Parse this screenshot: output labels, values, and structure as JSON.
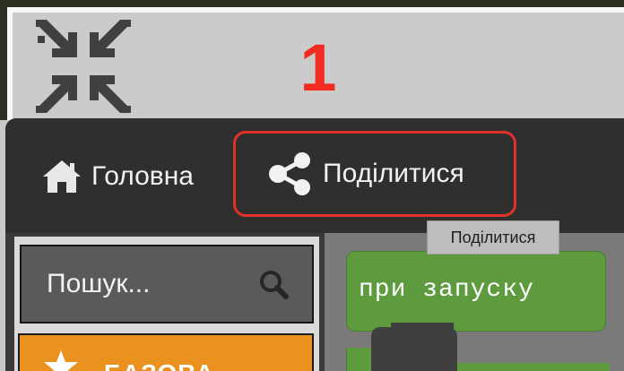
{
  "step_marker": "1",
  "icons": {
    "collapse": "collapse-arrows-icon",
    "home": "home-icon",
    "share": "share-icon",
    "search": "search-icon",
    "star": "star-icon"
  },
  "header": {
    "home_label": "Головна",
    "share_label": "Поділитися"
  },
  "tooltip": {
    "text": "Поділитися"
  },
  "toolbox": {
    "search_placeholder": "Пошук...",
    "categories": [
      {
        "label": "БАЗОВА",
        "color": "#ea9220"
      }
    ]
  },
  "workspace": {
    "blocks": [
      {
        "label": "при запуску",
        "color": "#5d9b3e"
      }
    ]
  },
  "colors": {
    "highlight": "#e2312b",
    "step_marker": "#f22c22",
    "header_bg": "#2f2f2f"
  }
}
